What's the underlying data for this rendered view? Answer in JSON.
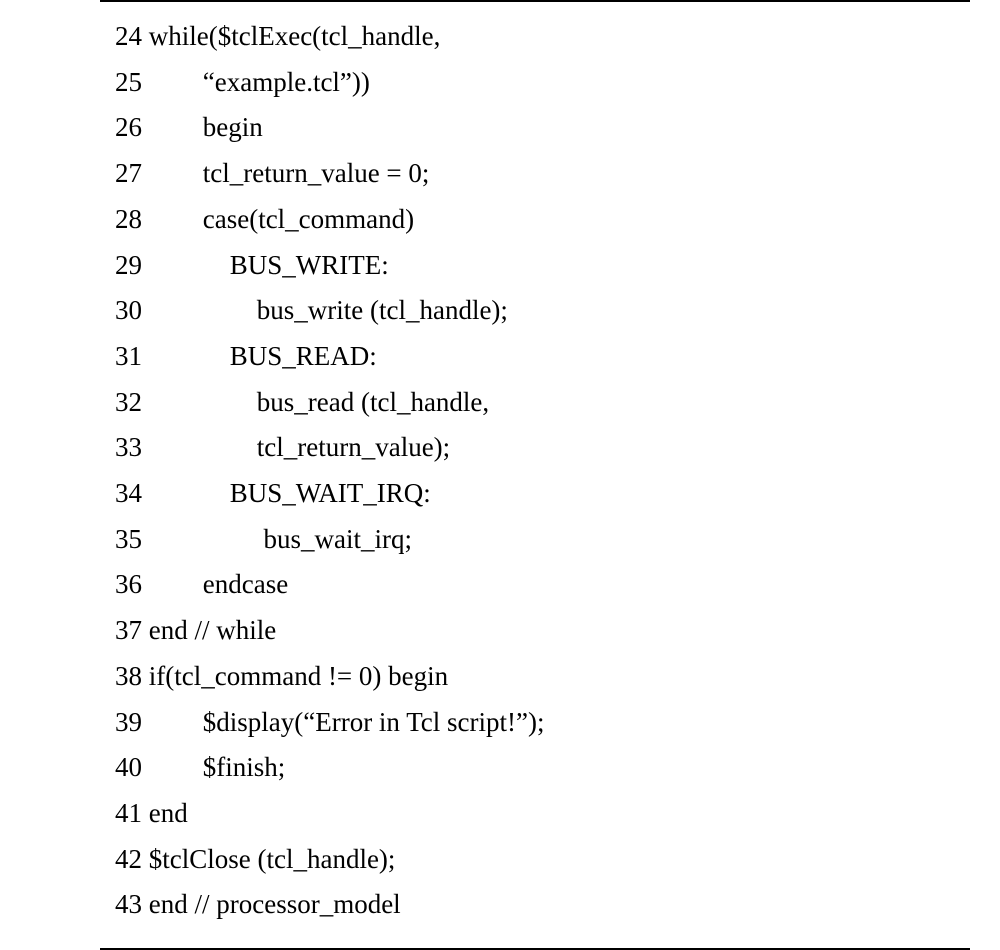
{
  "code": {
    "lines": [
      {
        "n": "24",
        "indent": " ",
        "text": "while($tclExec(tcl_handle,"
      },
      {
        "n": "25",
        "indent": "         ",
        "text": "“example.tcl”))"
      },
      {
        "n": "26",
        "indent": "         ",
        "text": "begin"
      },
      {
        "n": "27",
        "indent": "         ",
        "text": "tcl_return_value = 0;"
      },
      {
        "n": "28",
        "indent": "         ",
        "text": "case(tcl_command)"
      },
      {
        "n": "29",
        "indent": "             ",
        "text": "BUS_WRITE:"
      },
      {
        "n": "30",
        "indent": "                 ",
        "text": "bus_write (tcl_handle);"
      },
      {
        "n": "31",
        "indent": "             ",
        "text": "BUS_READ:"
      },
      {
        "n": "32",
        "indent": "                 ",
        "text": "bus_read (tcl_handle,"
      },
      {
        "n": "33",
        "indent": "                 ",
        "text": "tcl_return_value);"
      },
      {
        "n": "34",
        "indent": "             ",
        "text": "BUS_WAIT_IRQ:"
      },
      {
        "n": "35",
        "indent": "                  ",
        "text": "bus_wait_irq;"
      },
      {
        "n": "36",
        "indent": "         ",
        "text": "endcase"
      },
      {
        "n": "37",
        "indent": " ",
        "text": "end // while"
      },
      {
        "n": "38",
        "indent": " ",
        "text": "if(tcl_command != 0) begin"
      },
      {
        "n": "39",
        "indent": "         ",
        "text": "$display(“Error in Tcl script!”);"
      },
      {
        "n": "40",
        "indent": "         ",
        "text": "$finish;"
      },
      {
        "n": "41",
        "indent": " ",
        "text": "end"
      },
      {
        "n": "42",
        "indent": " ",
        "text": "$tclClose (tcl_handle);"
      },
      {
        "n": "43",
        "indent": " ",
        "text": "end // processor_model"
      }
    ]
  }
}
